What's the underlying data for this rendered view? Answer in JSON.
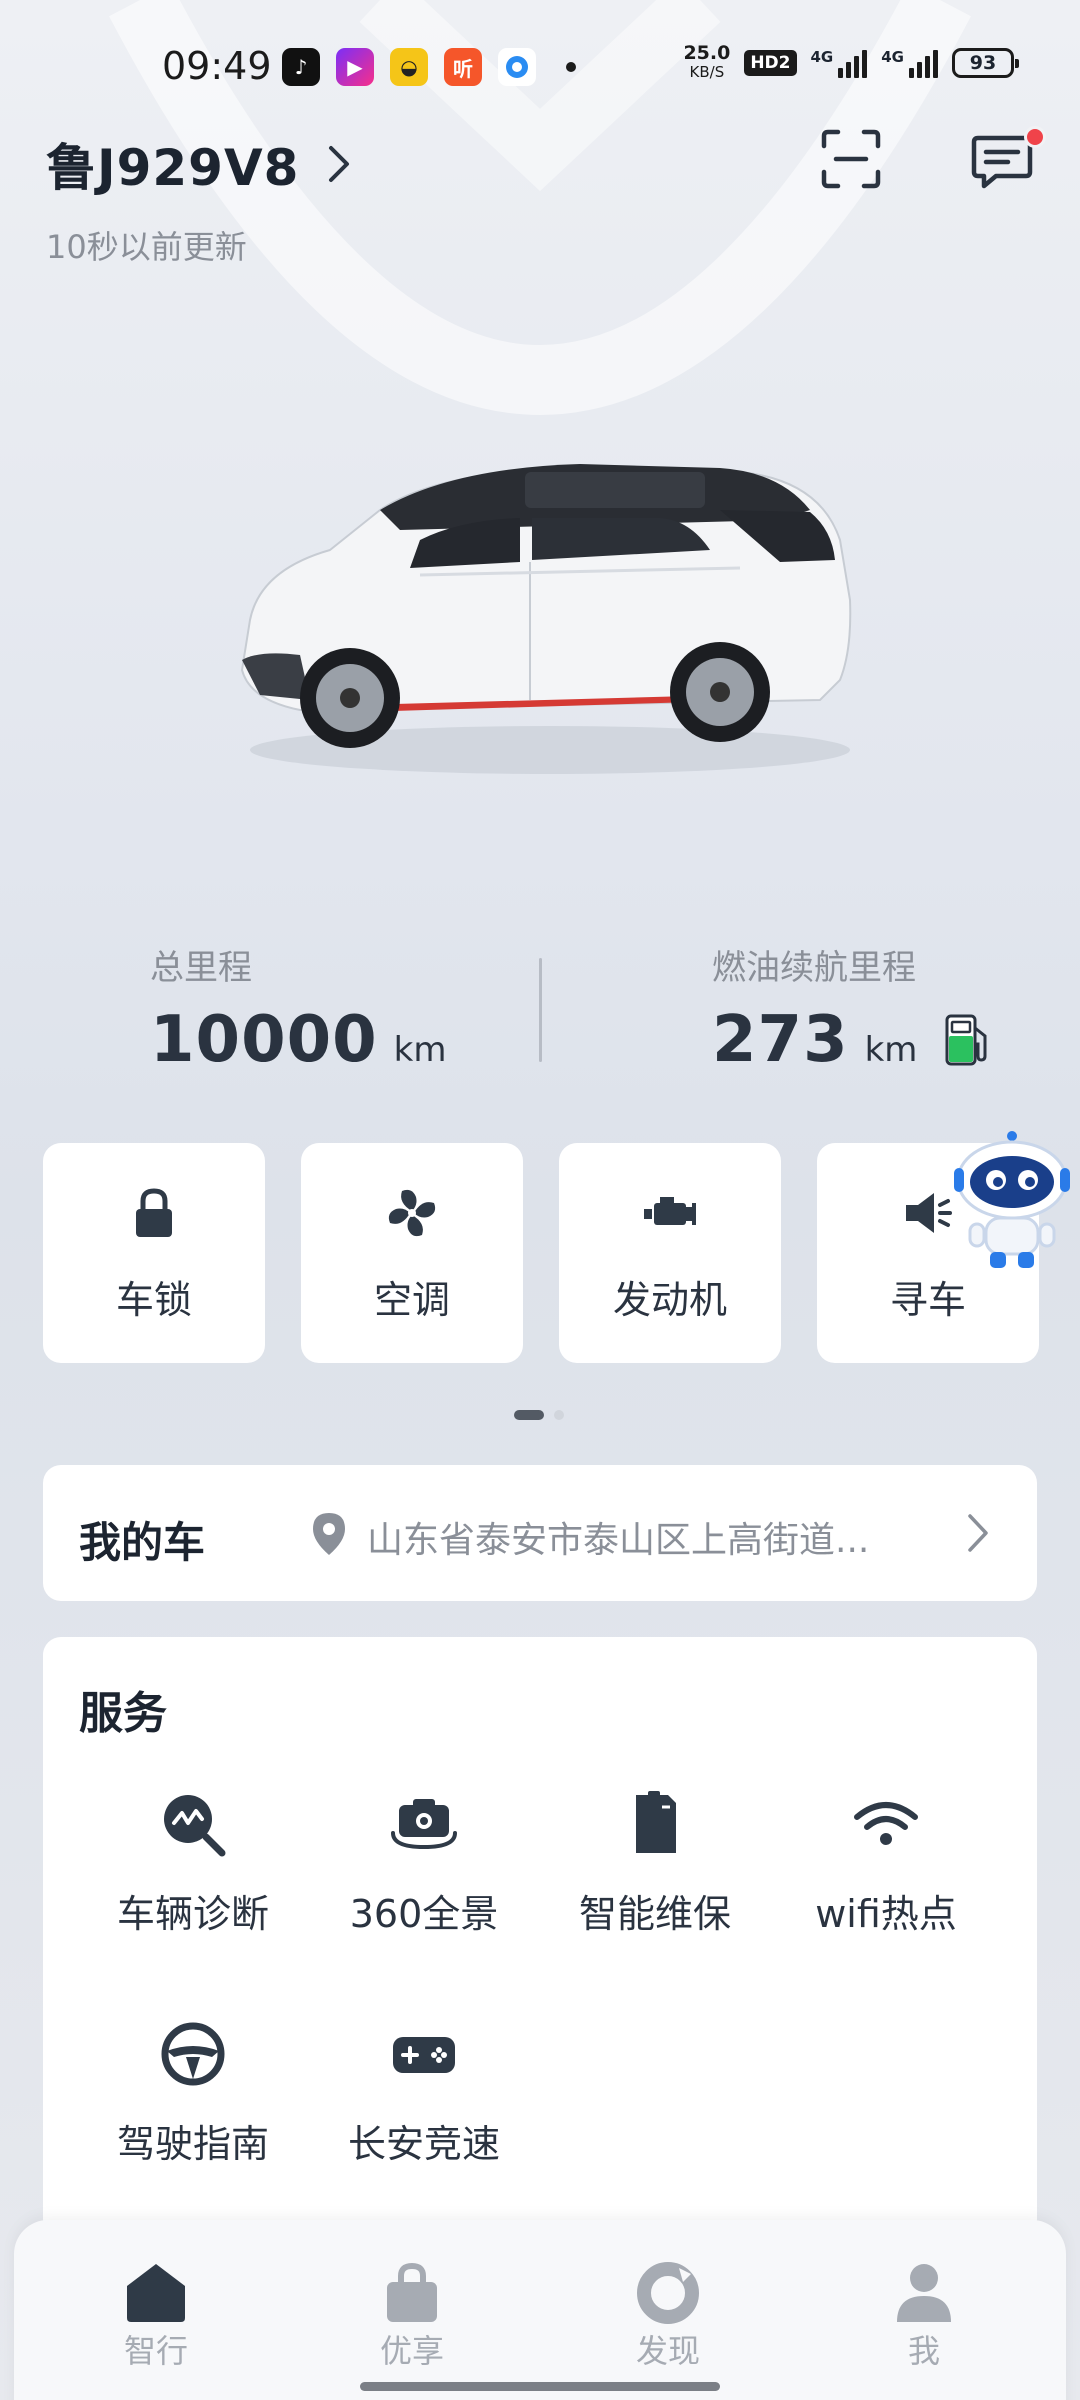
{
  "status_bar": {
    "time": "09:49",
    "net_speed": "25.0",
    "net_speed_unit": "KB/S",
    "hd": "HD2",
    "signal1": "4G",
    "signal2": "4G",
    "battery": "93",
    "app_icons": [
      "douyin-icon",
      "video-player-icon",
      "yellow-app-icon",
      "listen-app-icon",
      "blue-circle-app-icon",
      "more-dot-icon"
    ]
  },
  "header": {
    "plate": "鲁J929V8",
    "updated": "10秒以前更新"
  },
  "stats": {
    "total_label": "总里程",
    "total_value": "10000",
    "total_unit": "km",
    "range_label": "燃油续航里程",
    "range_value": "273",
    "range_unit": "km"
  },
  "controls": [
    {
      "label": "车锁",
      "icon": "lock-icon"
    },
    {
      "label": "空调",
      "icon": "fan-icon"
    },
    {
      "label": "发动机",
      "icon": "engine-icon"
    },
    {
      "label": "寻车",
      "icon": "speaker-icon"
    }
  ],
  "pager": {
    "pages": 2,
    "active": 0
  },
  "my_car": {
    "title": "我的车",
    "address": "山东省泰安市泰山区上高街道..."
  },
  "services": {
    "title": "服务",
    "items": [
      {
        "label": "车辆诊断",
        "icon": "diagnosis-icon"
      },
      {
        "label": "360全景",
        "icon": "camera-360-icon"
      },
      {
        "label": "智能维保",
        "icon": "maintenance-icon"
      },
      {
        "label": "wifi热点",
        "icon": "wifi-icon"
      },
      {
        "label": "驾驶指南",
        "icon": "steering-wheel-icon"
      },
      {
        "label": "长安竞速",
        "icon": "gamepad-icon"
      }
    ]
  },
  "bottom_nav": [
    {
      "label": "智行",
      "icon": "home-icon",
      "active": true
    },
    {
      "label": "优享",
      "icon": "bag-icon",
      "active": false
    },
    {
      "label": "发现",
      "icon": "discover-icon",
      "active": false
    },
    {
      "label": "我",
      "icon": "profile-icon",
      "active": false
    }
  ],
  "colors": {
    "accent_dark": "#2f3a47",
    "fuel_green": "#2bc15f",
    "notification_red": "#f0434a",
    "card_bg": "#ffffff"
  }
}
